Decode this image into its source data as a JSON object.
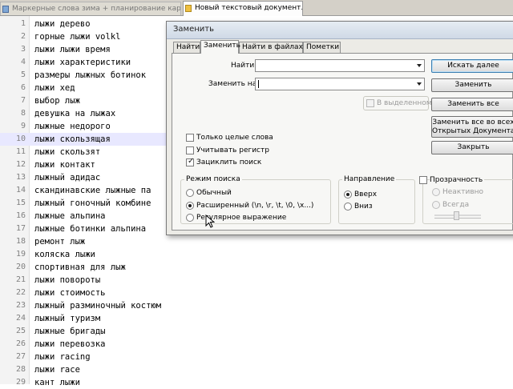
{
  "editor": {
    "tabs": [
      {
        "label": "Маркерные слова зима + планирование карты.txt"
      },
      {
        "label": "Новый текстовый документ.txt"
      }
    ],
    "lines": [
      {
        "n": "1",
        "text": "лыжи дерево"
      },
      {
        "n": "2",
        "text": "горные лыжи volkl"
      },
      {
        "n": "3",
        "text": "лыжи лыжи время"
      },
      {
        "n": "4",
        "text": "лыжи характеристики"
      },
      {
        "n": "5",
        "text": "размеры лыжных ботинок"
      },
      {
        "n": "6",
        "text": "лыжи хед"
      },
      {
        "n": "7",
        "text": "выбор лыж"
      },
      {
        "n": "8",
        "text": "девушка на лыжах"
      },
      {
        "n": "9",
        "text": "лыжные недорого"
      },
      {
        "n": "10",
        "text": "лыжи скользящая"
      },
      {
        "n": "11",
        "text": "лыжи скользят"
      },
      {
        "n": "12",
        "text": "лыжи контакт"
      },
      {
        "n": "13",
        "text": "лыжный адидас"
      },
      {
        "n": "14",
        "text": "скандинавские лыжные па"
      },
      {
        "n": "15",
        "text": "лыжный гоночный комбине"
      },
      {
        "n": "16",
        "text": "лыжные альпина"
      },
      {
        "n": "17",
        "text": "лыжные ботинки альпина"
      },
      {
        "n": "18",
        "text": "ремонт лыж"
      },
      {
        "n": "19",
        "text": "коляска лыжи"
      },
      {
        "n": "20",
        "text": "спортивная для лыж"
      },
      {
        "n": "21",
        "text": "лыжи повороты"
      },
      {
        "n": "22",
        "text": "лыжи стоимость"
      },
      {
        "n": "23",
        "text": "лыжный разминочный костюм"
      },
      {
        "n": "24",
        "text": "лыжный туризм"
      },
      {
        "n": "25",
        "text": "лыжные бригады"
      },
      {
        "n": "26",
        "text": "лыжи перевозка"
      },
      {
        "n": "27",
        "text": "лыжи racing"
      },
      {
        "n": "28",
        "text": "лыжи race"
      },
      {
        "n": "29",
        "text": "кант лыжи"
      }
    ]
  },
  "dialog": {
    "title": "Заменить",
    "tabs": [
      "Найти",
      "Заменить",
      "Найти в файлах",
      "Пометки"
    ],
    "find_label": "Найти:",
    "find_value": "",
    "replace_label": "Заменить на:",
    "replace_value": "",
    "in_selection": "В выделенном",
    "buttons": {
      "find_next": "Искать далее",
      "replace": "Заменить",
      "replace_all": "Заменить все",
      "replace_all_open_1": "Заменить все во всех",
      "replace_all_open_2": "Открытых Документах",
      "close": "Закрыть"
    },
    "options": {
      "whole_words": "Только целые слова",
      "match_case": "Учитывать регистр",
      "wrap_around": "Зациклить поиск"
    },
    "search_mode": {
      "title": "Режим поиска",
      "normal": "Обычный",
      "extended": "Расширенный (\\n, \\r, \\t, \\0, \\x...)",
      "regex": "Регулярное выражение"
    },
    "direction": {
      "title": "Направление",
      "up": "Вверх",
      "down": "Вниз"
    },
    "transparency": {
      "title": "Прозрачность",
      "on_inactive": "Неактивно",
      "always": "Всегда"
    }
  }
}
